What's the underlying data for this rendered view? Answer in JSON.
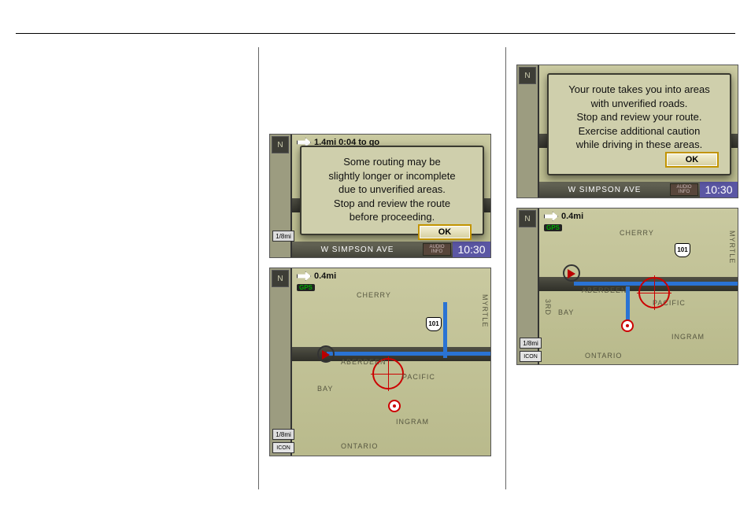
{
  "modal_a": {
    "message": "Some routing may be\nslightly longer or incomplete\ndue to unverified areas.\nStop and review the route\nbefore proceeding.",
    "ok_label": "OK"
  },
  "modal_c": {
    "message": "Your route takes you into areas\nwith unverified roads.\nStop and review your route.\nExercise additional caution\nwhile driving in these areas.",
    "ok_label": "OK"
  },
  "nav_common": {
    "compass": "N",
    "gps_badge": "GPS",
    "route_shield": "101",
    "audio_line1": "AUDIO",
    "audio_line2": "INFO",
    "street": "W SIMPSON AVE",
    "clock": "10:30",
    "scale": "1/8mi",
    "icon_button": "ICON"
  },
  "panel_a": {
    "distance": "1.4mi 0:04 to go"
  },
  "panel_b": {
    "distance": "0.4mi",
    "labels": {
      "cherry": "CHERRY",
      "aberdeen": "ABERDEEN",
      "pacific": "PACIFIC",
      "bay": "BAY",
      "ingram": "INGRAM",
      "ontario": "ONTARIO",
      "myrtle": "MYRTLE"
    }
  },
  "panel_d": {
    "distance": "0.4mi",
    "labels": {
      "cherry": "CHERRY",
      "aberdeen": "ABERDEEN",
      "pacific": "PACIFIC",
      "bay": "BAY",
      "ingram": "INGRAM",
      "ontario": "ONTARIO",
      "myrtle": "MYRTLE",
      "third": "3RD"
    }
  }
}
